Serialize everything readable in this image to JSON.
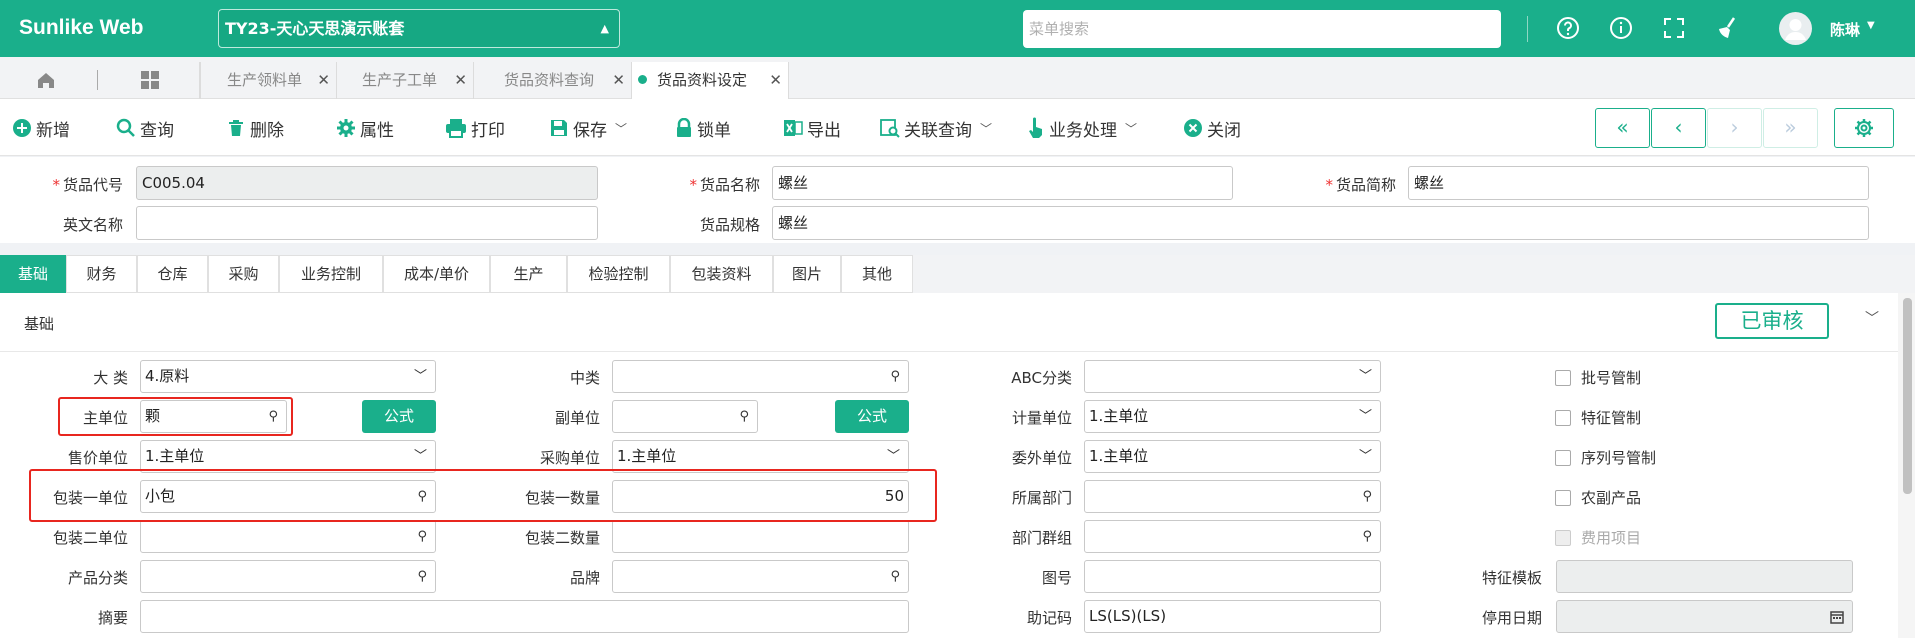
{
  "app": {
    "logo": "Sunlike Web",
    "account": "TY23-天心天思演示账套",
    "search_placeholder": "菜单搜索",
    "user": "陈琳"
  },
  "tabs": [
    {
      "label": "生产领料单"
    },
    {
      "label": "生产子工单"
    },
    {
      "label": "货品资料查询"
    },
    {
      "label": "货品资料设定"
    }
  ],
  "toolbar": {
    "add": "新增",
    "query": "查询",
    "delete": "删除",
    "property": "属性",
    "print": "打印",
    "save": "保存",
    "lock": "锁单",
    "export": "导出",
    "related": "关联查询",
    "business": "业务处理",
    "close": "关闭"
  },
  "nav": {
    "first": "«",
    "prev": "‹",
    "next": "›",
    "last": "»"
  },
  "header": {
    "item_code_label": "货品代号",
    "item_code": "C005.04",
    "item_name_label": "货品名称",
    "item_name": "螺丝",
    "item_short_label": "货品简称",
    "item_short": "螺丝",
    "en_name_label": "英文名称",
    "en_name": "",
    "spec_label": "货品规格",
    "spec": "螺丝"
  },
  "form_tabs": [
    "基础",
    "财务",
    "仓库",
    "采购",
    "业务控制",
    "成本/单价",
    "生产",
    "检验控制",
    "包装资料",
    "图片",
    "其他"
  ],
  "section": {
    "title": "基础",
    "status": "已审核"
  },
  "fields": {
    "big_class_label": "大 类",
    "big_class": "4.原料",
    "mid_class_label": "中类",
    "mid_class": "",
    "abc_label": "ABC分类",
    "abc": "",
    "main_unit_label": "主单位",
    "main_unit": "颗",
    "formula_btn": "公式",
    "sub_unit_label": "副单位",
    "sub_unit": "",
    "calc_unit_label": "计量单位",
    "calc_unit": "1.主单位",
    "sale_unit_label": "售价单位",
    "sale_unit": "1.主单位",
    "purchase_unit_label": "采购单位",
    "purchase_unit": "1.主单位",
    "outsource_unit_label": "委外单位",
    "outsource_unit": "1.主单位",
    "pack1_unit_label": "包装一单位",
    "pack1_unit": "小包",
    "pack1_qty_label": "包装一数量",
    "pack1_qty": "50",
    "dept_label": "所属部门",
    "dept": "",
    "pack2_unit_label": "包装二单位",
    "pack2_unit": "",
    "pack2_qty_label": "包装二数量",
    "pack2_qty": "",
    "dept_group_label": "部门群组",
    "dept_group": "",
    "product_class_label": "产品分类",
    "product_class": "",
    "brand_label": "品牌",
    "brand": "",
    "drawing_label": "图号",
    "drawing": "",
    "feature_tpl_label": "特征模板",
    "feature_tpl": "",
    "summary_label": "摘要",
    "summary": "",
    "mnemonic_label": "助记码",
    "mnemonic": "LS(LS)(LS)",
    "stop_date_label": "停用日期",
    "stop_date": ""
  },
  "checkboxes": {
    "batch": "批号管制",
    "feature": "特征管制",
    "serial": "序列号管制",
    "agri": "农副产品",
    "expense": "费用项目"
  },
  "colors": {
    "accent": "#1aaf8b",
    "highlight": "#e8261f"
  }
}
